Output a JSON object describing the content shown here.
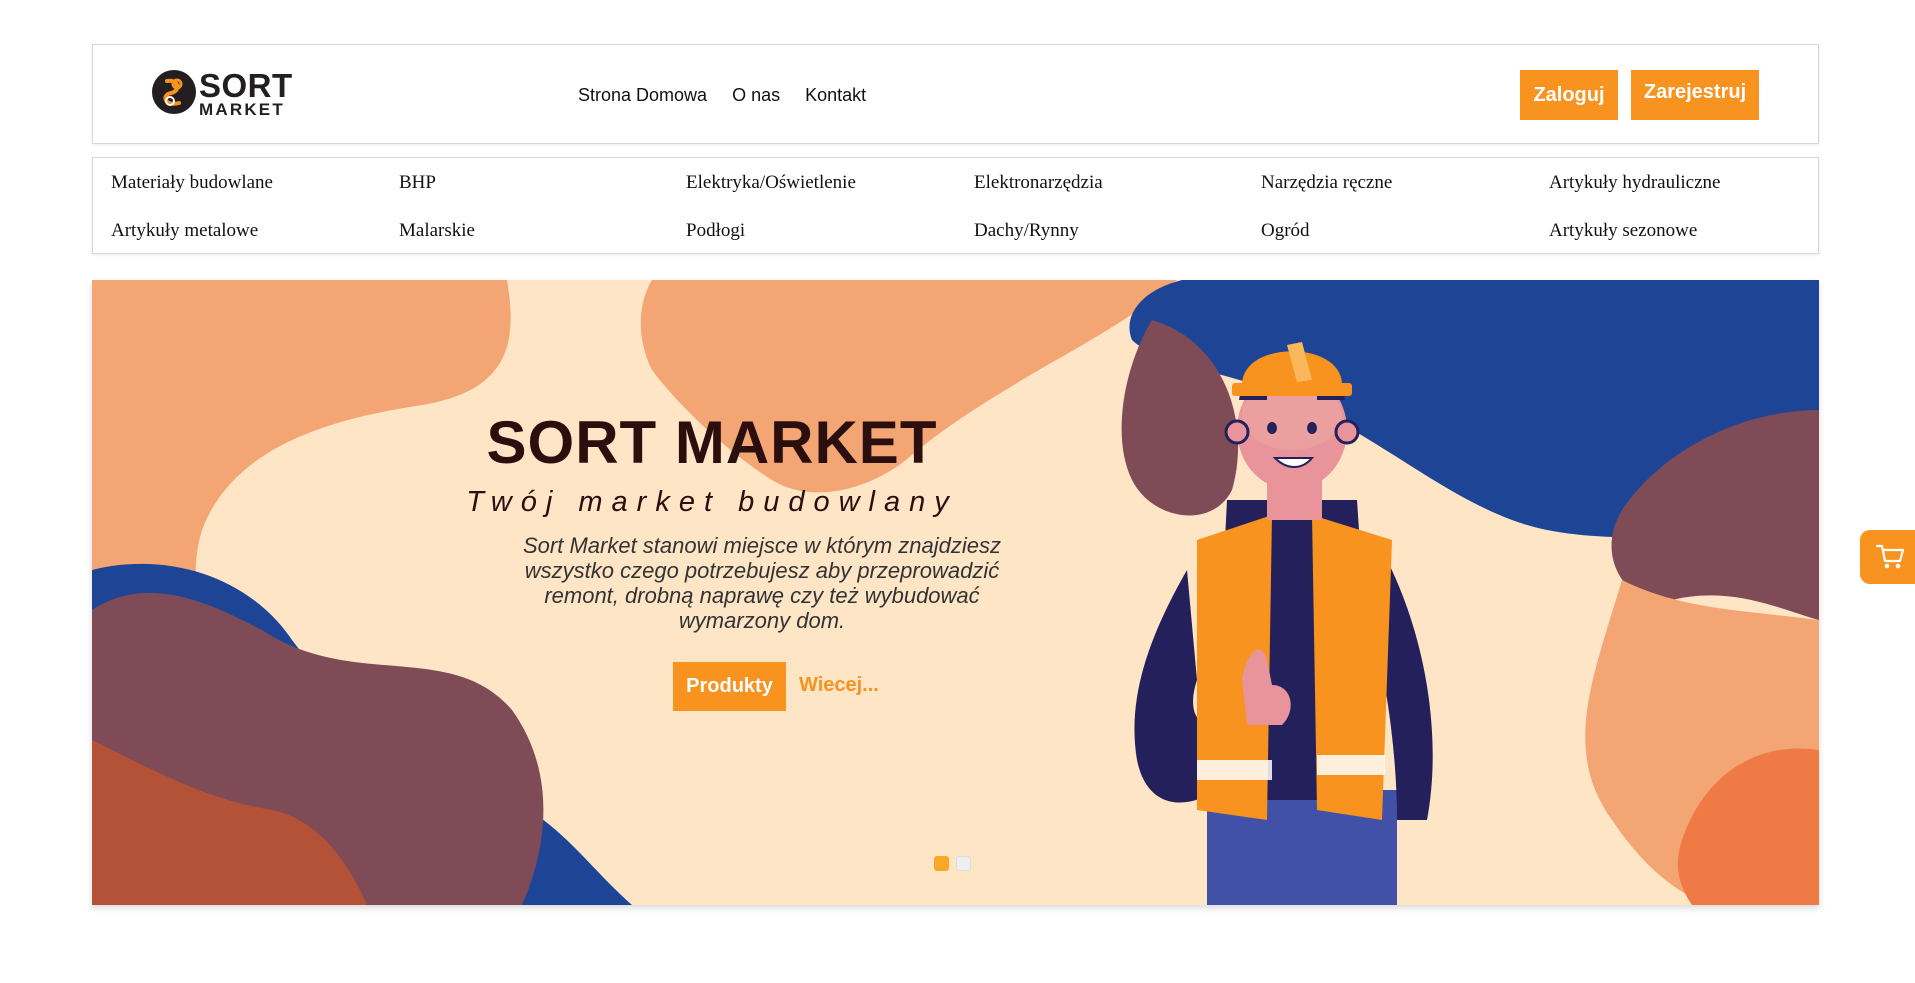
{
  "header": {
    "logo": {
      "line1": "SORT",
      "line2": "MARKET",
      "mark_color": "#f7931e",
      "dark_color": "#231f20"
    },
    "nav": [
      {
        "label": "Strona Domowa"
      },
      {
        "label": "O nas"
      },
      {
        "label": "Kontakt"
      }
    ],
    "login_label": "Zaloguj",
    "register_label": "Zarejestruj"
  },
  "categories": [
    "Materiały budowlane",
    "BHP",
    "Elektryka/Oświetlenie",
    "Elektronarzędzia",
    "Narzędzia ręczne",
    "Artykuły hydrauliczne",
    "Artykuły metalowe",
    "Malarskie",
    "Podłogi",
    "Dachy/Rynny",
    "Ogród",
    "Artykuły sezonowe"
  ],
  "hero": {
    "title": "SORT MARKET",
    "subtitle": "Twój market budowlany",
    "description": "Sort Market stanowi miejsce w którym znajdziesz wszystko czego potrzebujesz aby przeprowadzić remont, drobną naprawę czy też wybudować wymarzony dom.",
    "products_label": "Produkty",
    "more_label": "Wiecej...",
    "slides": {
      "count": 2,
      "active": 1
    },
    "image": "construction-worker-illustration"
  },
  "cart": {
    "icon": "cart-icon"
  },
  "colors": {
    "accent": "#f7931e",
    "hero_bg": "#fde5c6",
    "blob_peach": "#f4a574",
    "blob_plum": "#7f4b57",
    "blob_blue": "#1e4496",
    "blob_rust": "#b35236"
  }
}
